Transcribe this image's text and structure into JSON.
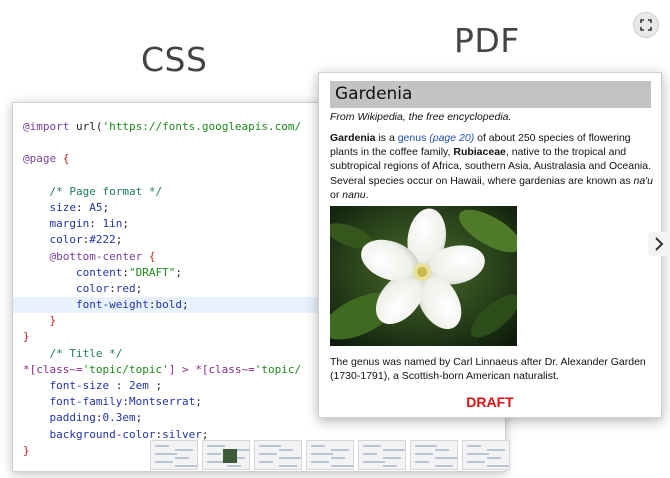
{
  "headings": {
    "css": "CSS",
    "pdf": "PDF"
  },
  "code_lines": [
    [
      {
        "c": "at",
        "t": "@import "
      },
      {
        "c": "fn",
        "t": "url("
      },
      {
        "c": "str",
        "t": "'https://fonts.googleapis.com/"
      }
    ],
    [],
    [
      {
        "c": "at",
        "t": "@page "
      },
      {
        "c": "br",
        "t": "{"
      }
    ],
    [],
    [
      {
        "c": "cm",
        "t": "    /* Page format */"
      }
    ],
    [
      {
        "c": "prop",
        "t": "    size"
      },
      {
        "c": "fn",
        "t": ": "
      },
      {
        "c": "val",
        "t": "A5"
      },
      {
        "c": "fn",
        "t": ";"
      }
    ],
    [
      {
        "c": "prop",
        "t": "    margin"
      },
      {
        "c": "fn",
        "t": ": "
      },
      {
        "c": "val",
        "t": "1in"
      },
      {
        "c": "fn",
        "t": ";"
      }
    ],
    [
      {
        "c": "prop",
        "t": "    color"
      },
      {
        "c": "fn",
        "t": ":"
      },
      {
        "c": "val",
        "t": "#222"
      },
      {
        "c": "fn",
        "t": ";"
      }
    ],
    [
      {
        "c": "at",
        "t": "    @bottom-center "
      },
      {
        "c": "br",
        "t": "{"
      }
    ],
    [
      {
        "c": "prop",
        "t": "        content"
      },
      {
        "c": "fn",
        "t": ":"
      },
      {
        "c": "str",
        "t": "\"DRAFT\""
      },
      {
        "c": "fn",
        "t": ";"
      }
    ],
    [
      {
        "c": "prop",
        "t": "        color"
      },
      {
        "c": "fn",
        "t": ":"
      },
      {
        "c": "val",
        "t": "red"
      },
      {
        "c": "fn",
        "t": ";"
      }
    ],
    [
      {
        "c": "prop",
        "t": "        font-weight"
      },
      {
        "c": "fn",
        "t": ":"
      },
      {
        "c": "val",
        "t": "bold"
      },
      {
        "c": "fn",
        "t": ";"
      }
    ],
    [
      {
        "c": "br",
        "t": "    }"
      }
    ],
    [
      {
        "c": "br",
        "t": "}"
      }
    ],
    [
      {
        "c": "cm",
        "t": "    /* Title */"
      }
    ],
    [
      {
        "c": "sel",
        "t": "*[class~="
      },
      {
        "c": "str",
        "t": "'topic/topic'"
      },
      {
        "c": "sel",
        "t": "] > *[class~="
      },
      {
        "c": "str",
        "t": "'topic/"
      }
    ],
    [
      {
        "c": "prop",
        "t": "    font-size "
      },
      {
        "c": "fn",
        "t": ": "
      },
      {
        "c": "val",
        "t": "2em"
      },
      {
        "c": "fn",
        "t": " ;"
      }
    ],
    [
      {
        "c": "prop",
        "t": "    font-family"
      },
      {
        "c": "fn",
        "t": ":"
      },
      {
        "c": "val",
        "t": "Montserrat"
      },
      {
        "c": "fn",
        "t": ";"
      }
    ],
    [
      {
        "c": "prop",
        "t": "    padding"
      },
      {
        "c": "fn",
        "t": ":"
      },
      {
        "c": "val",
        "t": "0.3em"
      },
      {
        "c": "fn",
        "t": ";"
      }
    ],
    [
      {
        "c": "prop",
        "t": "    background-color"
      },
      {
        "c": "fn",
        "t": ":"
      },
      {
        "c": "val",
        "t": "silver"
      },
      {
        "c": "fn",
        "t": ";"
      }
    ],
    [
      {
        "c": "br",
        "t": "}"
      }
    ]
  ],
  "highlighted_line": 11,
  "pdf": {
    "title": "Gardenia",
    "subtitle": "From Wikipedia, the free encyclopedia.",
    "para1": {
      "bold1": "Gardenia",
      "t1": " is a ",
      "link1": "genus",
      "link2": "(page  20)",
      "t2": " of about 250 species of flowering plants in the coffee family, ",
      "bold2": "Rubiaceae",
      "t3": ", native to the tropical and subtropical regions of Africa, southern Asia, Australasia and Oceania. Several species occur on Hawaii, where gardenias are known as ",
      "it1": "na'u",
      "t4": " or ",
      "it2": "nanu",
      "t5": "."
    },
    "para2": "The genus was named by Carl Linnaeus after Dr. Alexander Garden (1730-1791), a Scottish-born American naturalist.",
    "footer": "DRAFT"
  },
  "icons": {
    "expand": "expand-icon",
    "next": "chevron-right-icon"
  },
  "thumbnail_count": 7
}
